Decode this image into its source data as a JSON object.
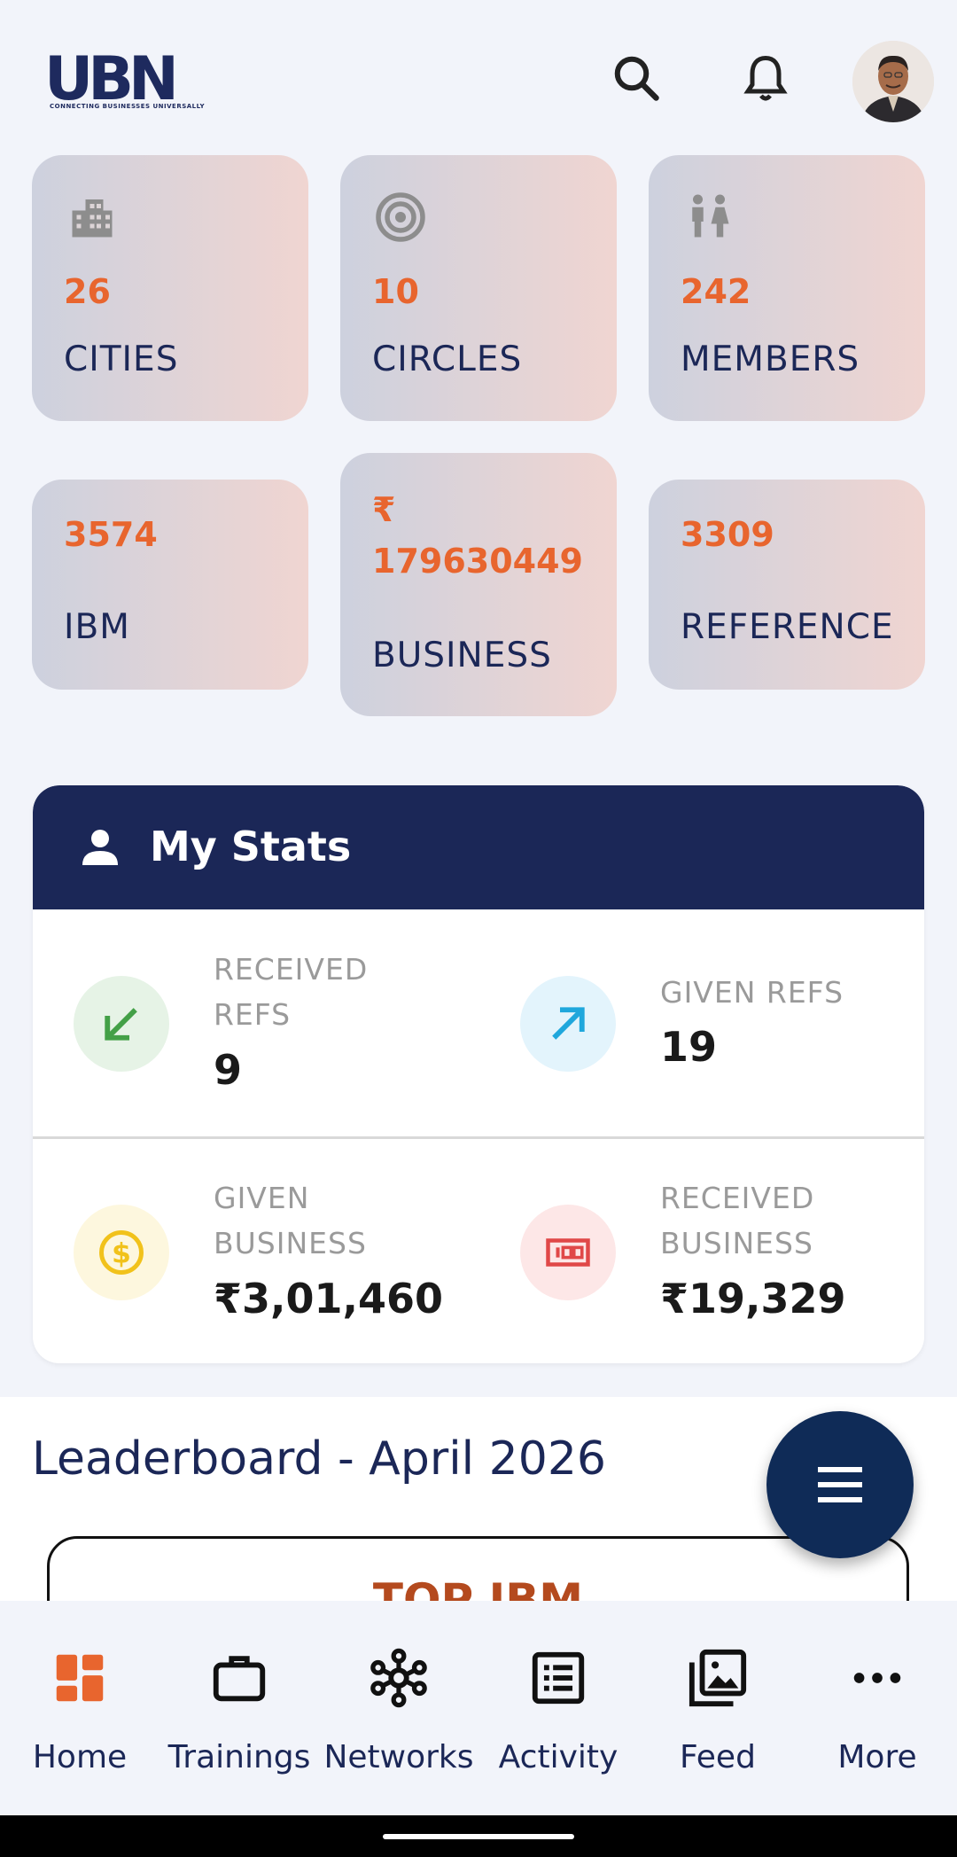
{
  "header": {
    "logo_text": "UBN",
    "logo_tagline": "CONNECTING BUSINESSES UNIVERSALLY",
    "icons": [
      "search-icon",
      "bell-icon",
      "avatar"
    ]
  },
  "tiles": {
    "cities": {
      "value": "26",
      "label": "CITIES",
      "icon": "building-icon"
    },
    "circles": {
      "value": "10",
      "label": "CIRCLES",
      "icon": "target-icon"
    },
    "members": {
      "value": "242",
      "label": "MEMBERS",
      "icon": "people-icon"
    },
    "ibm": {
      "value": "3574",
      "label": "IBM"
    },
    "business": {
      "currency": "₹",
      "value": "179630449",
      "label": "BUSINESS"
    },
    "reference": {
      "value": "3309",
      "label": "REFERENCE"
    }
  },
  "my_stats": {
    "title": "My Stats",
    "received_refs": {
      "label_line1": "RECEIVED",
      "label_line2": "REFS",
      "value": "9"
    },
    "given_refs": {
      "label": "GIVEN REFS",
      "value": "19"
    },
    "given_business": {
      "label_line1": "GIVEN",
      "label_line2": "BUSINESS",
      "value": "₹3,01,460"
    },
    "received_business": {
      "label_line1": "RECEIVED",
      "label_line2": "BUSINESS",
      "value": "₹19,329"
    }
  },
  "leaderboard": {
    "title": "Leaderboard - April 2026",
    "box_title": "TOP IBM"
  },
  "bottom_nav": {
    "items": [
      {
        "label": "Home",
        "icon": "home-grid-icon",
        "active": true
      },
      {
        "label": "Trainings",
        "icon": "briefcase-icon"
      },
      {
        "label": "Networks",
        "icon": "network-icon"
      },
      {
        "label": "Activity",
        "icon": "list-icon"
      },
      {
        "label": "Feed",
        "icon": "gallery-icon"
      },
      {
        "label": "More",
        "icon": "more-dots-icon"
      }
    ]
  },
  "colors": {
    "accent": "#e8652e",
    "navy": "#1b2757",
    "fab": "#0f2b57"
  }
}
